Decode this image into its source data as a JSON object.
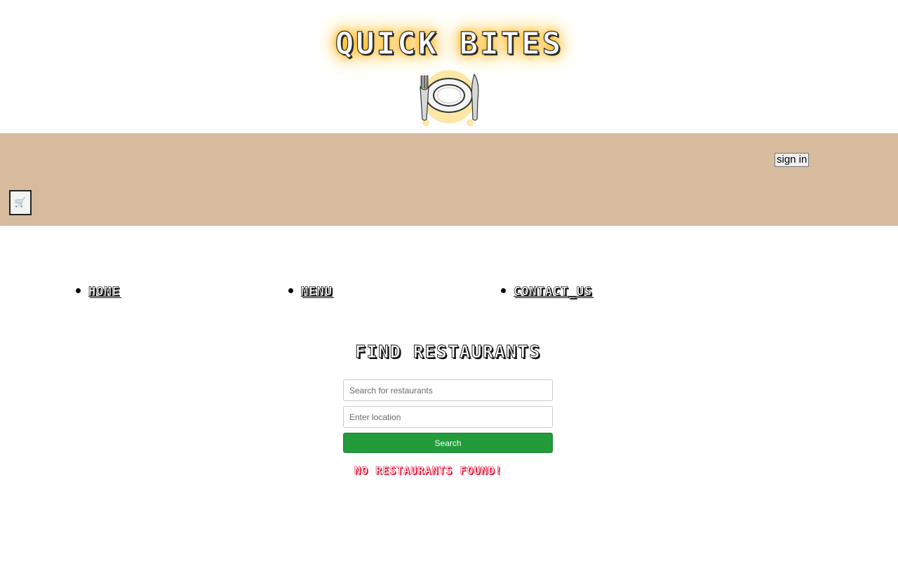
{
  "brand": {
    "title": "QUICK BITES",
    "logo_icon": "plate-with-fork-and-knife-icon",
    "glow_color": "#ffb400"
  },
  "nav": {
    "items": [
      {
        "label": "Home"
      },
      {
        "label": "Menu"
      },
      {
        "label": "Contact_us"
      }
    ],
    "signin_label": "sign in",
    "cart_icon": "🛒",
    "background_color": "#d6bc9c"
  },
  "search": {
    "title": "FIND RESTAURANTS",
    "query_placeholder": "Search for restaurants",
    "query_value": "",
    "location_placeholder": "Enter location",
    "location_value": "",
    "button_label": "Search",
    "button_color": "#229b3a",
    "empty_message": "No Restaurants Found!",
    "empty_message_color": "#e0173a"
  }
}
